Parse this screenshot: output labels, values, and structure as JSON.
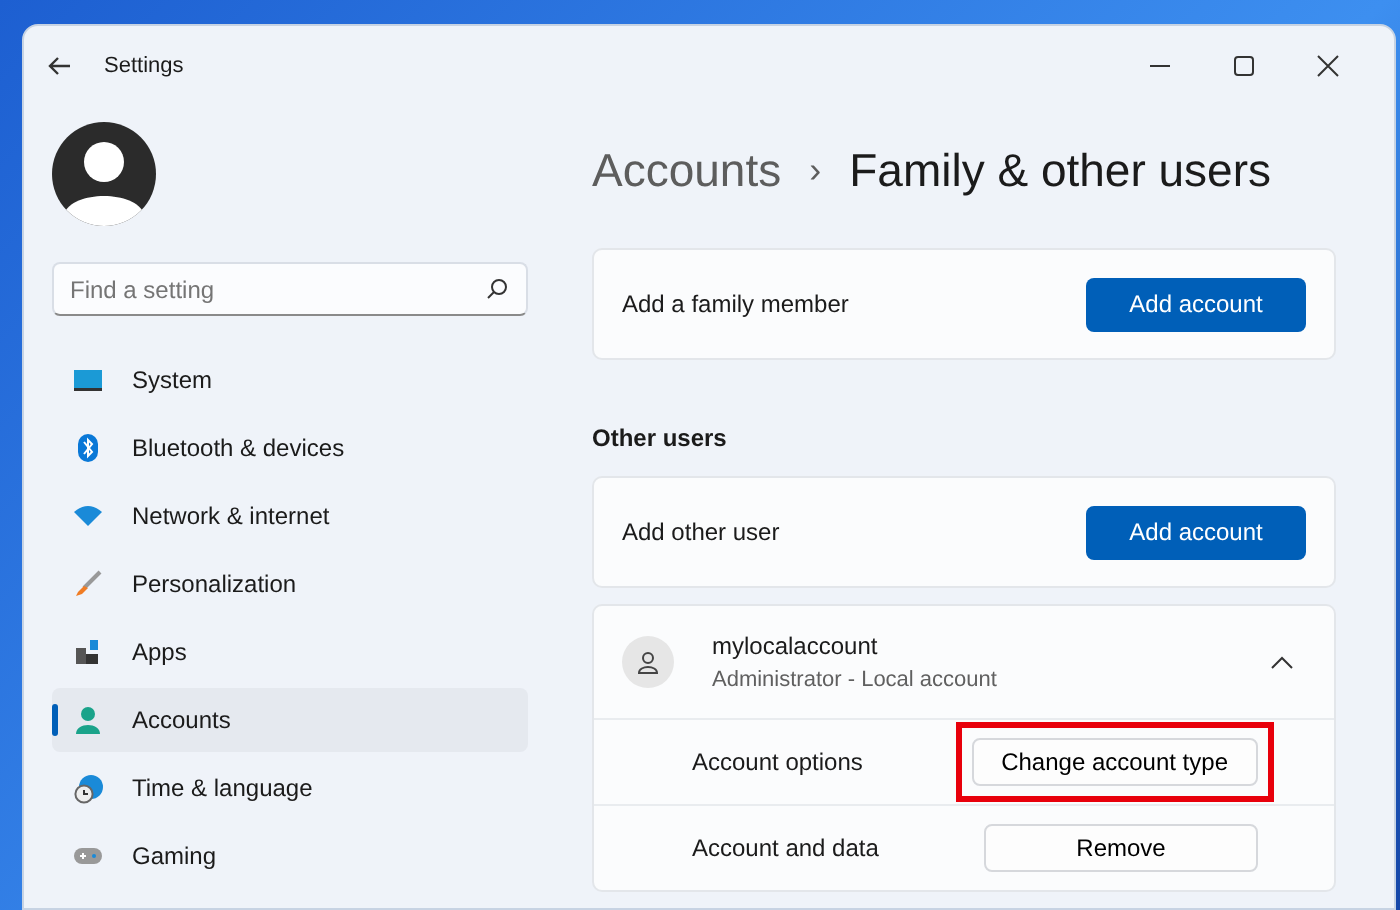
{
  "window": {
    "title": "Settings"
  },
  "search": {
    "placeholder": "Find a setting"
  },
  "sidebar": {
    "items": [
      {
        "label": "System",
        "selected": false
      },
      {
        "label": "Bluetooth & devices",
        "selected": false
      },
      {
        "label": "Network & internet",
        "selected": false
      },
      {
        "label": "Personalization",
        "selected": false
      },
      {
        "label": "Apps",
        "selected": false
      },
      {
        "label": "Accounts",
        "selected": true
      },
      {
        "label": "Time & language",
        "selected": false
      },
      {
        "label": "Gaming",
        "selected": false
      }
    ]
  },
  "breadcrumb": {
    "parent": "Accounts",
    "separator": "›",
    "current": "Family & other users"
  },
  "family": {
    "label": "Add a family member",
    "button": "Add account"
  },
  "other_users": {
    "heading": "Other users",
    "label": "Add other user",
    "button": "Add account"
  },
  "user": {
    "name": "mylocalaccount",
    "subtitle": "Administrator - Local account",
    "expanded": true,
    "options": [
      {
        "label": "Account options",
        "button": "Change account type",
        "highlighted": true
      },
      {
        "label": "Account and data",
        "button": "Remove",
        "highlighted": false
      }
    ]
  }
}
